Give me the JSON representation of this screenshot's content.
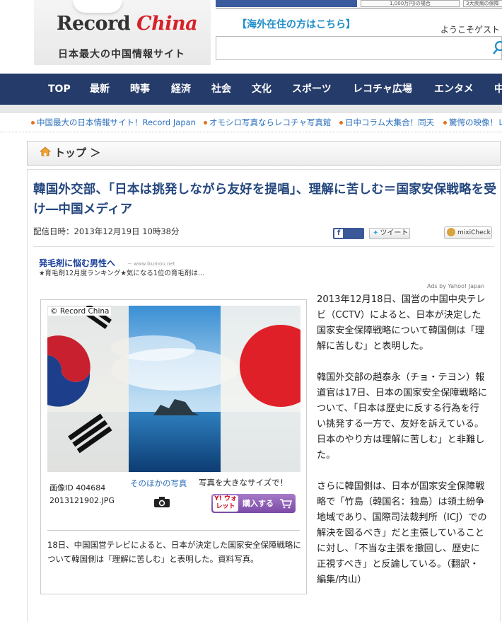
{
  "header": {
    "logo": {
      "brand_main": "Record ",
      "brand_accent": "China",
      "tagline": "日本最大の中国情報サイト"
    },
    "top_banner": {
      "center_text": "1,000万円)の場合",
      "right_text": "3大疾病の保障"
    },
    "overseas_link": "【海外在住の方はこちら】",
    "welcome": "ようこそゲスト",
    "search": {
      "placeholder": ""
    }
  },
  "nav": {
    "items": [
      "TOP",
      "最新",
      "時事",
      "経済",
      "社会",
      "文化",
      "スポーツ",
      "レコチャ広場",
      "エンタメ",
      "中"
    ]
  },
  "ticker": {
    "items": [
      "中国最大の日本情報サイト！Record Japan",
      "オモシロ写真ならレコチャ写真館",
      "日中コラム大集合！同天",
      "驚愕の映像！レ"
    ]
  },
  "breadcrumb": {
    "label": "トップ ＞"
  },
  "article": {
    "title": "韓国外交部、「日本は挑発しながら友好を提唱」、理解に苦しむ＝国家安保戦略を受け―中国メディア",
    "date": "配信日時：2013年12月19日 10時38分",
    "share": {
      "facebook": "Share",
      "twitter": "ツイート",
      "mixi": "mixiCheck"
    },
    "ad": {
      "title": "発毛剤に悩む男性へ",
      "url": "－ www.ikumou.net",
      "desc": "★育毛剤12月度ランキング★気になる1位の育毛剤は…",
      "credit": "Ads by Yahoo! Japan"
    },
    "photo": {
      "copyright": "© Record China",
      "image_id": "画像ID 404684",
      "filename": "2013121902.JPG",
      "more_photos": "そのほかの写真",
      "bigger": "写真を大きなサイズで！",
      "buy_brand": "Y! ウォレット",
      "buy_label": "購入する",
      "caption": "18日、中国国営テレビによると、日本が決定した国家安全保障戦略について韓国側は「理解に苦しむ」と表明した。資料写真。"
    },
    "paragraphs": [
      "2013年12月18日、国営の中国中央テレビ（CCTV）によると、日本が決定した国家安全保障戦略について韓国側は「理解に苦しむ」と表明した。",
      "韓国外交部の趙泰永（チョ・テヨン）報道官は17日、日本の国家安全保障戦略について、「日本は歴史に反する行為を行い挑発する一方で、友好を訴えている。日本のやり方は理解に苦しむ」と非難した。",
      "さらに韓国側は、日本が国家安全保障戦略で「竹島（韓国名：独島）は領土紛争地域であり、国際司法裁判所（ICJ）での解決を図るべき」だと主張していることに対し、「不当な主張を撤回し、歴史に正視すべき」と反論している。（翻訳・編集/内山）"
    ]
  }
}
